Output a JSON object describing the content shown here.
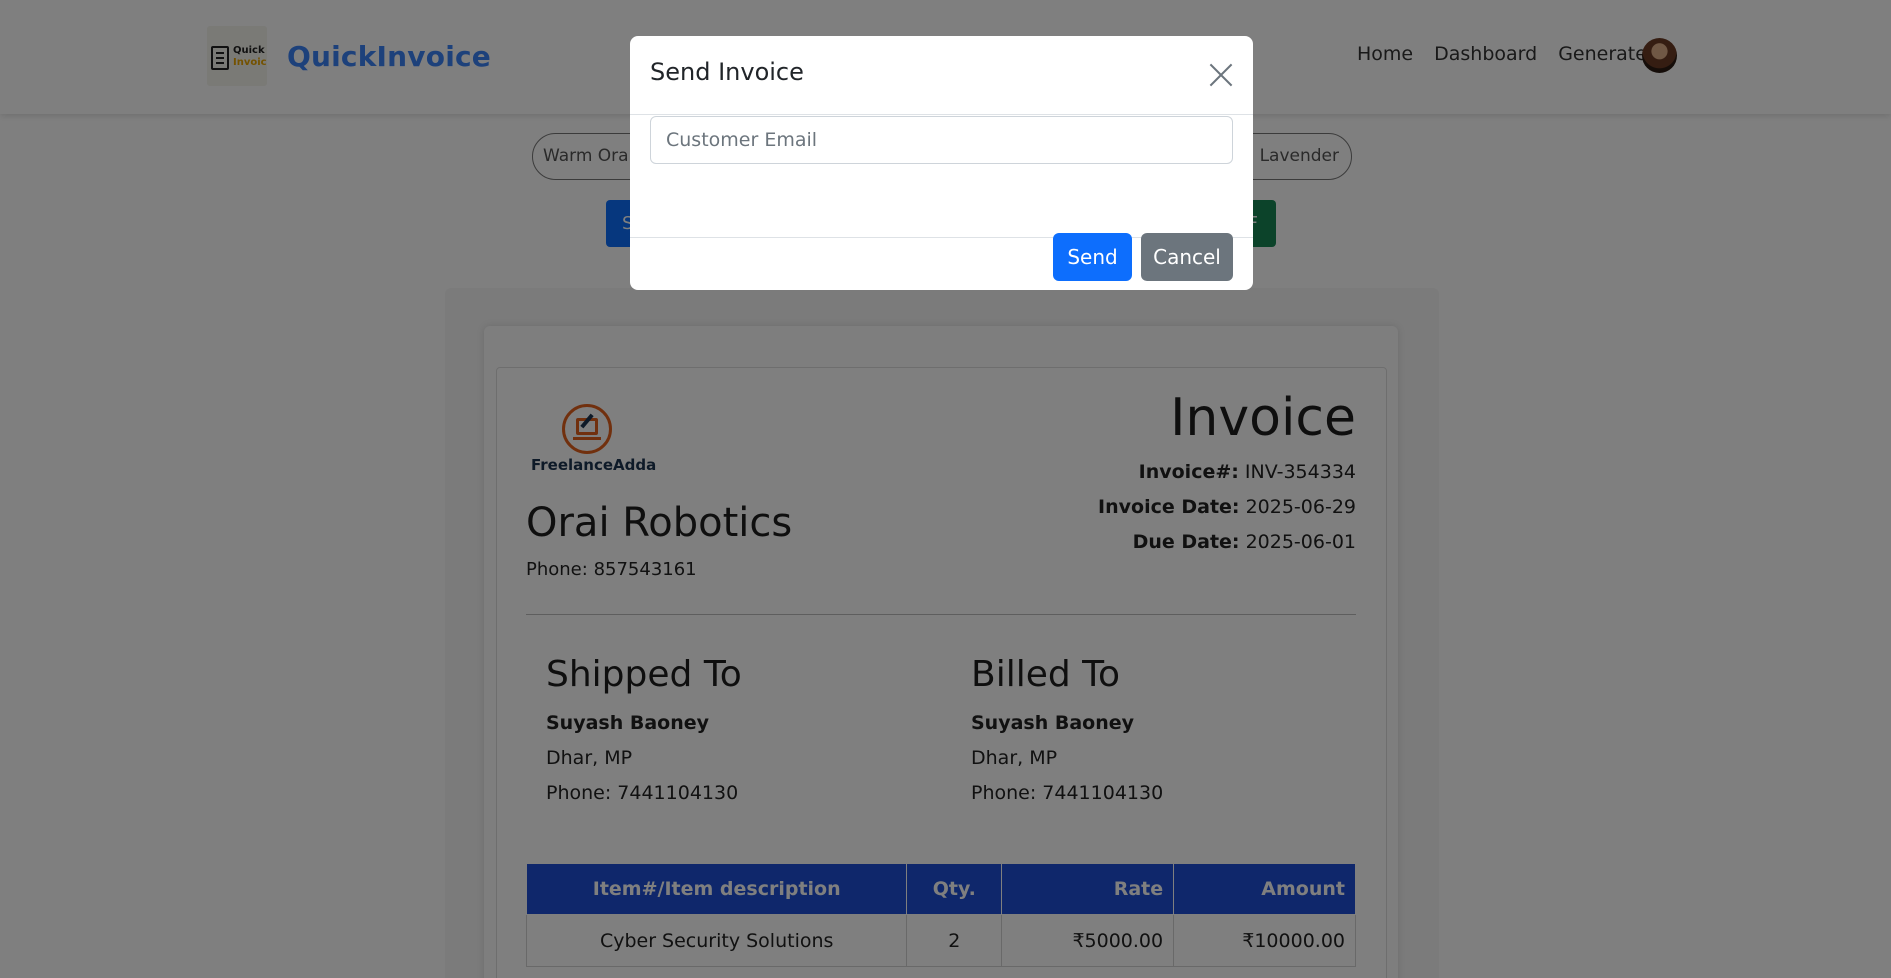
{
  "brand": {
    "name": "QuickInvoice",
    "logo_line1": "Quick",
    "logo_line2": "Invoice"
  },
  "nav": {
    "home": "Home",
    "dashboard": "Dashboard",
    "generate": "Generate"
  },
  "theme": {
    "left_option": "Warm Oran",
    "right_option": "al Lavender"
  },
  "toolbar": {
    "left_button": "S",
    "right_button": "F"
  },
  "invoice": {
    "logo_text": "FreelanceAdda",
    "company": "Orai Robotics",
    "phone_label": "Phone:",
    "phone": "857543161",
    "title": "Invoice",
    "number_label": "Invoice#:",
    "number": "INV-354334",
    "date_label": "Invoice Date:",
    "date": "2025-06-29",
    "due_label": "Due Date:",
    "due": "2025-06-01",
    "shipped": {
      "heading": "Shipped To",
      "name": "Suyash Baoney",
      "city": "Dhar, MP",
      "phone": "Phone: 7441104130"
    },
    "billed": {
      "heading": "Billed To",
      "name": "Suyash Baoney",
      "city": "Dhar, MP",
      "phone": "Phone: 7441104130"
    },
    "table": {
      "headers": [
        "Item#/Item description",
        "Qty.",
        "Rate",
        "Amount"
      ],
      "rows": [
        {
          "item": "Cyber Security Solutions",
          "qty": "2",
          "rate": "₹5000.00",
          "amount": "₹10000.00"
        }
      ]
    }
  },
  "modal": {
    "title": "Send Invoice",
    "email_placeholder": "Customer Email",
    "email_value": "",
    "send_label": "Send",
    "cancel_label": "Cancel"
  },
  "colors": {
    "brand": "#3b82f6",
    "primary": "#0d6efd",
    "secondary": "#6c757d",
    "table_header": "#1e4fd6",
    "accent_logo": "#e2611c"
  }
}
